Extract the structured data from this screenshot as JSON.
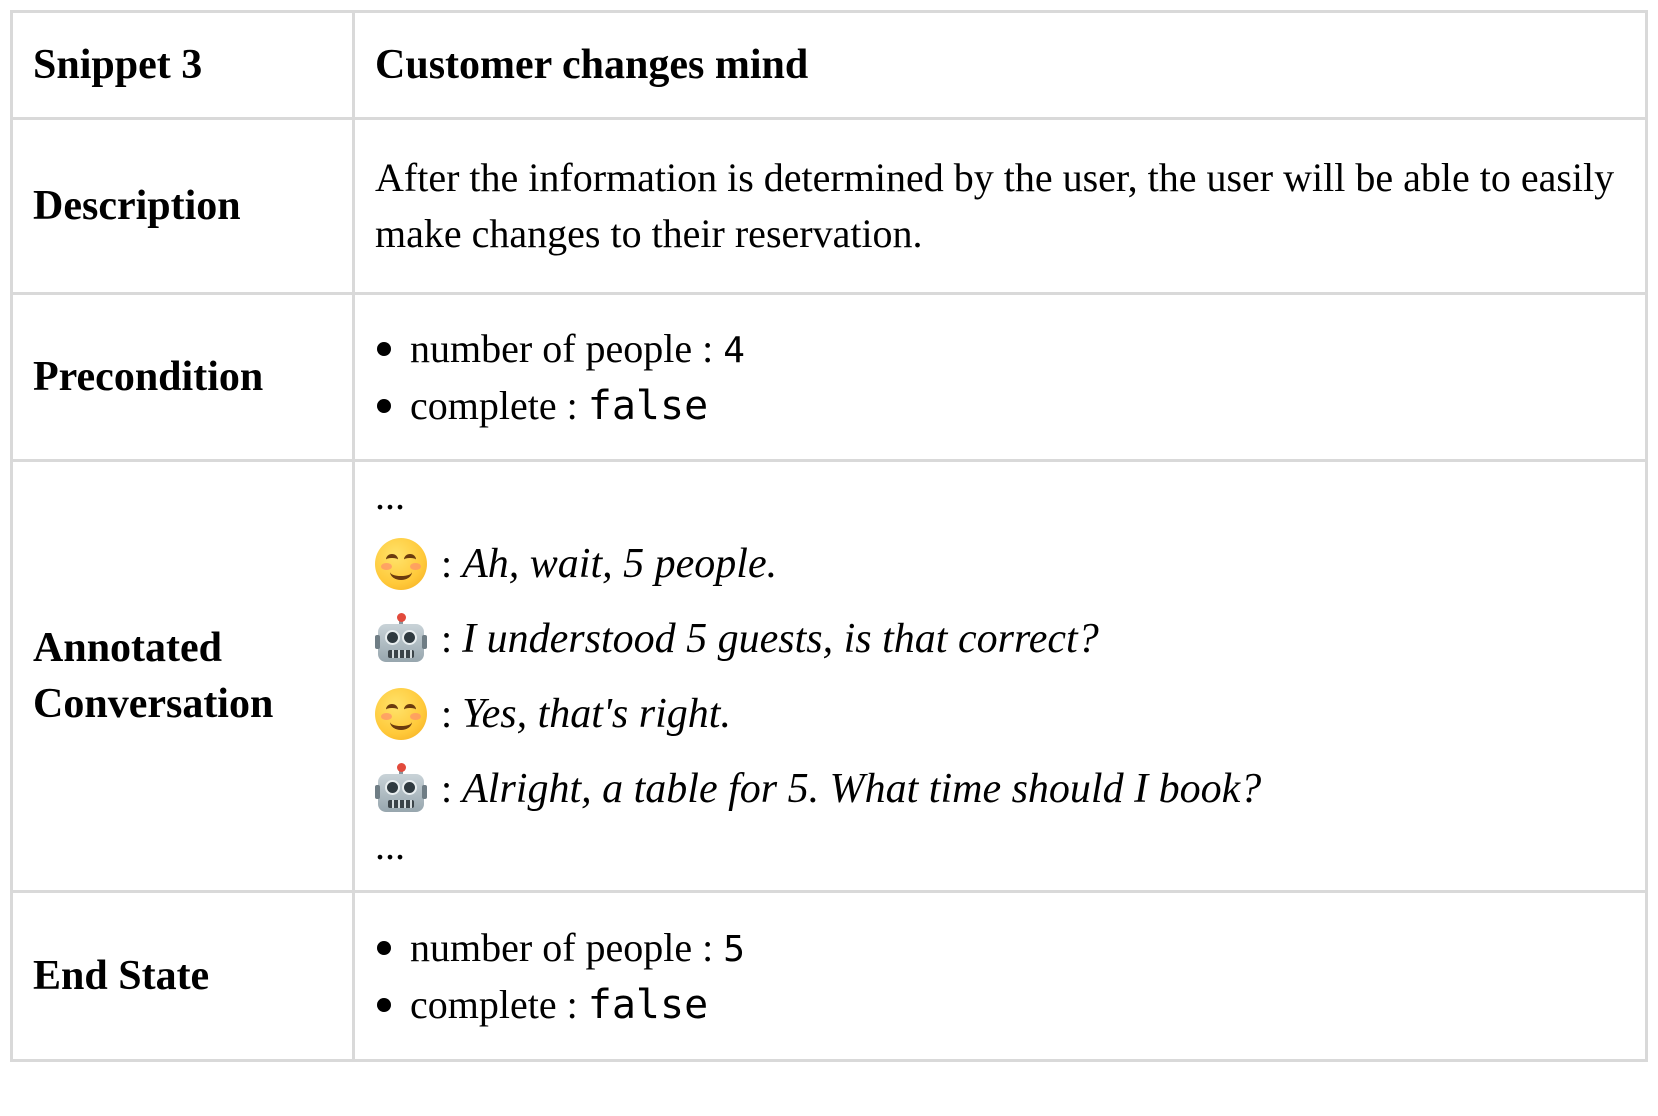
{
  "title_row": {
    "label": "Snippet 3",
    "value": "Customer changes mind"
  },
  "description": {
    "label": "Description",
    "text": "After the information is determined by the user, the user will be able to easily make changes to their reservation."
  },
  "precondition": {
    "label": "Precondition",
    "items": [
      {
        "key": "number of people",
        "sep": ":",
        "value": "4"
      },
      {
        "key": "complete",
        "sep": ":",
        "value": "false"
      }
    ]
  },
  "conversation": {
    "label_line1": "Annotated",
    "label_line2": "Conversation",
    "ellipsis_top": "...",
    "ellipsis_bottom": "...",
    "turns": [
      {
        "speaker_icon": "smiling-face-icon",
        "sep": ":",
        "text": "Ah, wait, 5 people."
      },
      {
        "speaker_icon": "robot-icon",
        "sep": ":",
        "text": "I understood 5 guests, is that correct?"
      },
      {
        "speaker_icon": "smiling-face-icon",
        "sep": ":",
        "text": "Yes, that's right."
      },
      {
        "speaker_icon": "robot-icon",
        "sep": ":",
        "text": "Alright, a table for 5. What time should I book?"
      }
    ]
  },
  "end_state": {
    "label": "End State",
    "items": [
      {
        "key": "number of people",
        "sep": ":",
        "value": "5"
      },
      {
        "key": "complete",
        "sep": ":",
        "value": "false"
      }
    ]
  },
  "colors": {
    "border": "#d9d9d9",
    "text": "#000000",
    "background": "#ffffff"
  }
}
